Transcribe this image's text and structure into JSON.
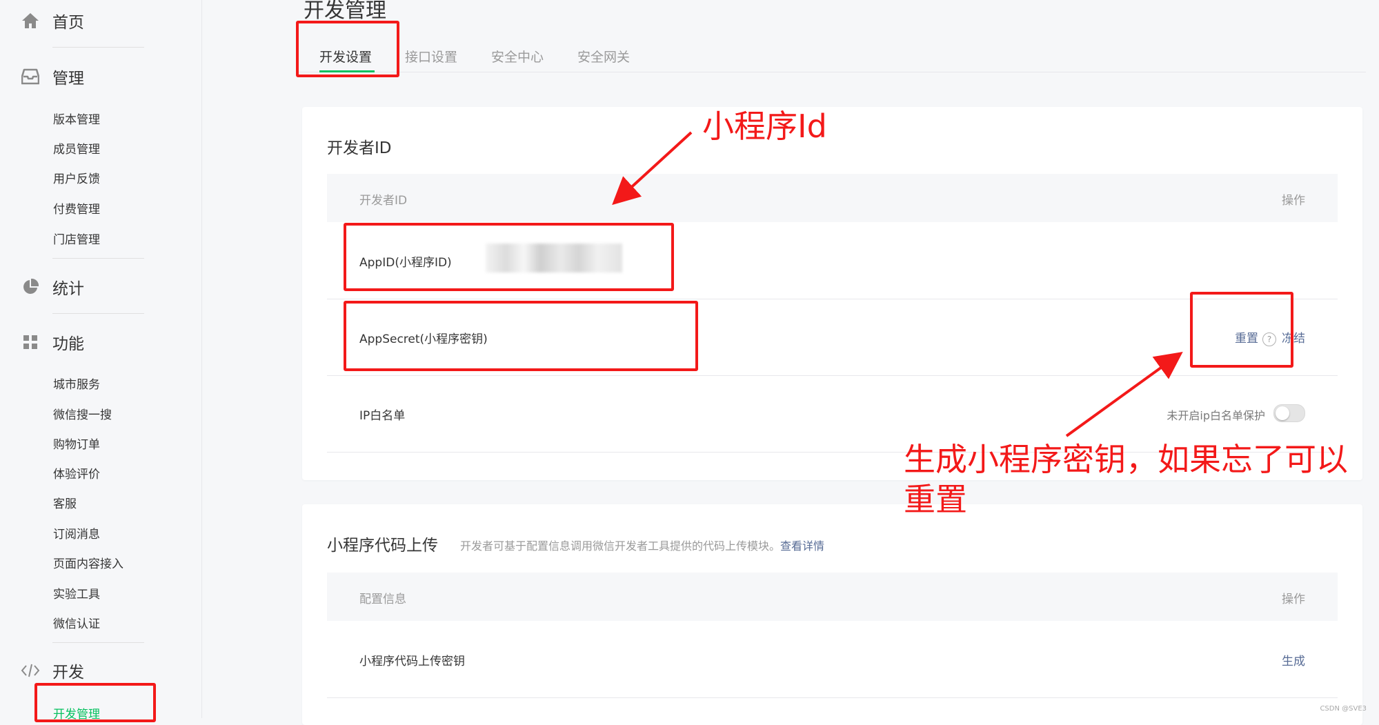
{
  "sidebar": {
    "home": "首页",
    "manage": "管理",
    "manage_items": [
      "版本管理",
      "成员管理",
      "用户反馈",
      "付费管理",
      "门店管理"
    ],
    "stats": "统计",
    "features": "功能",
    "feature_items": [
      "城市服务",
      "微信搜一搜",
      "购物订单",
      "体验评价",
      "客服",
      "订阅消息",
      "页面内容接入",
      "实验工具",
      "微信认证"
    ],
    "dev": "开发",
    "dev_items": [
      "开发管理"
    ]
  },
  "main": {
    "page_title": "开发管理",
    "tabs": [
      "开发设置",
      "接口设置",
      "安全中心",
      "安全网关"
    ],
    "developer_id": {
      "title": "开发者ID",
      "col_name": "开发者ID",
      "col_action": "操作",
      "appid_label": "AppID(小程序ID)",
      "appsecret_label": "AppSecret(小程序密钥)",
      "reset": "重置",
      "help": "?",
      "freeze": "冻结",
      "ip_label": "IP白名单",
      "ip_status": "未开启ip白名单保护"
    },
    "upload": {
      "title": "小程序代码上传",
      "desc": "开发者可基于配置信息调用微信开发者工具提供的代码上传模块。",
      "desc_link": "查看详情",
      "col_config": "配置信息",
      "col_action": "操作",
      "key_label": "小程序代码上传密钥",
      "generate": "生成"
    }
  },
  "annotations": {
    "appid_note": "小程序Id",
    "secret_note": "生成小程序密钥，如果忘了可以重置"
  },
  "watermark": "CSDN @SVE3",
  "colors": {
    "accent": "#07c160",
    "link": "#576b95",
    "annotation": "#f31919"
  }
}
